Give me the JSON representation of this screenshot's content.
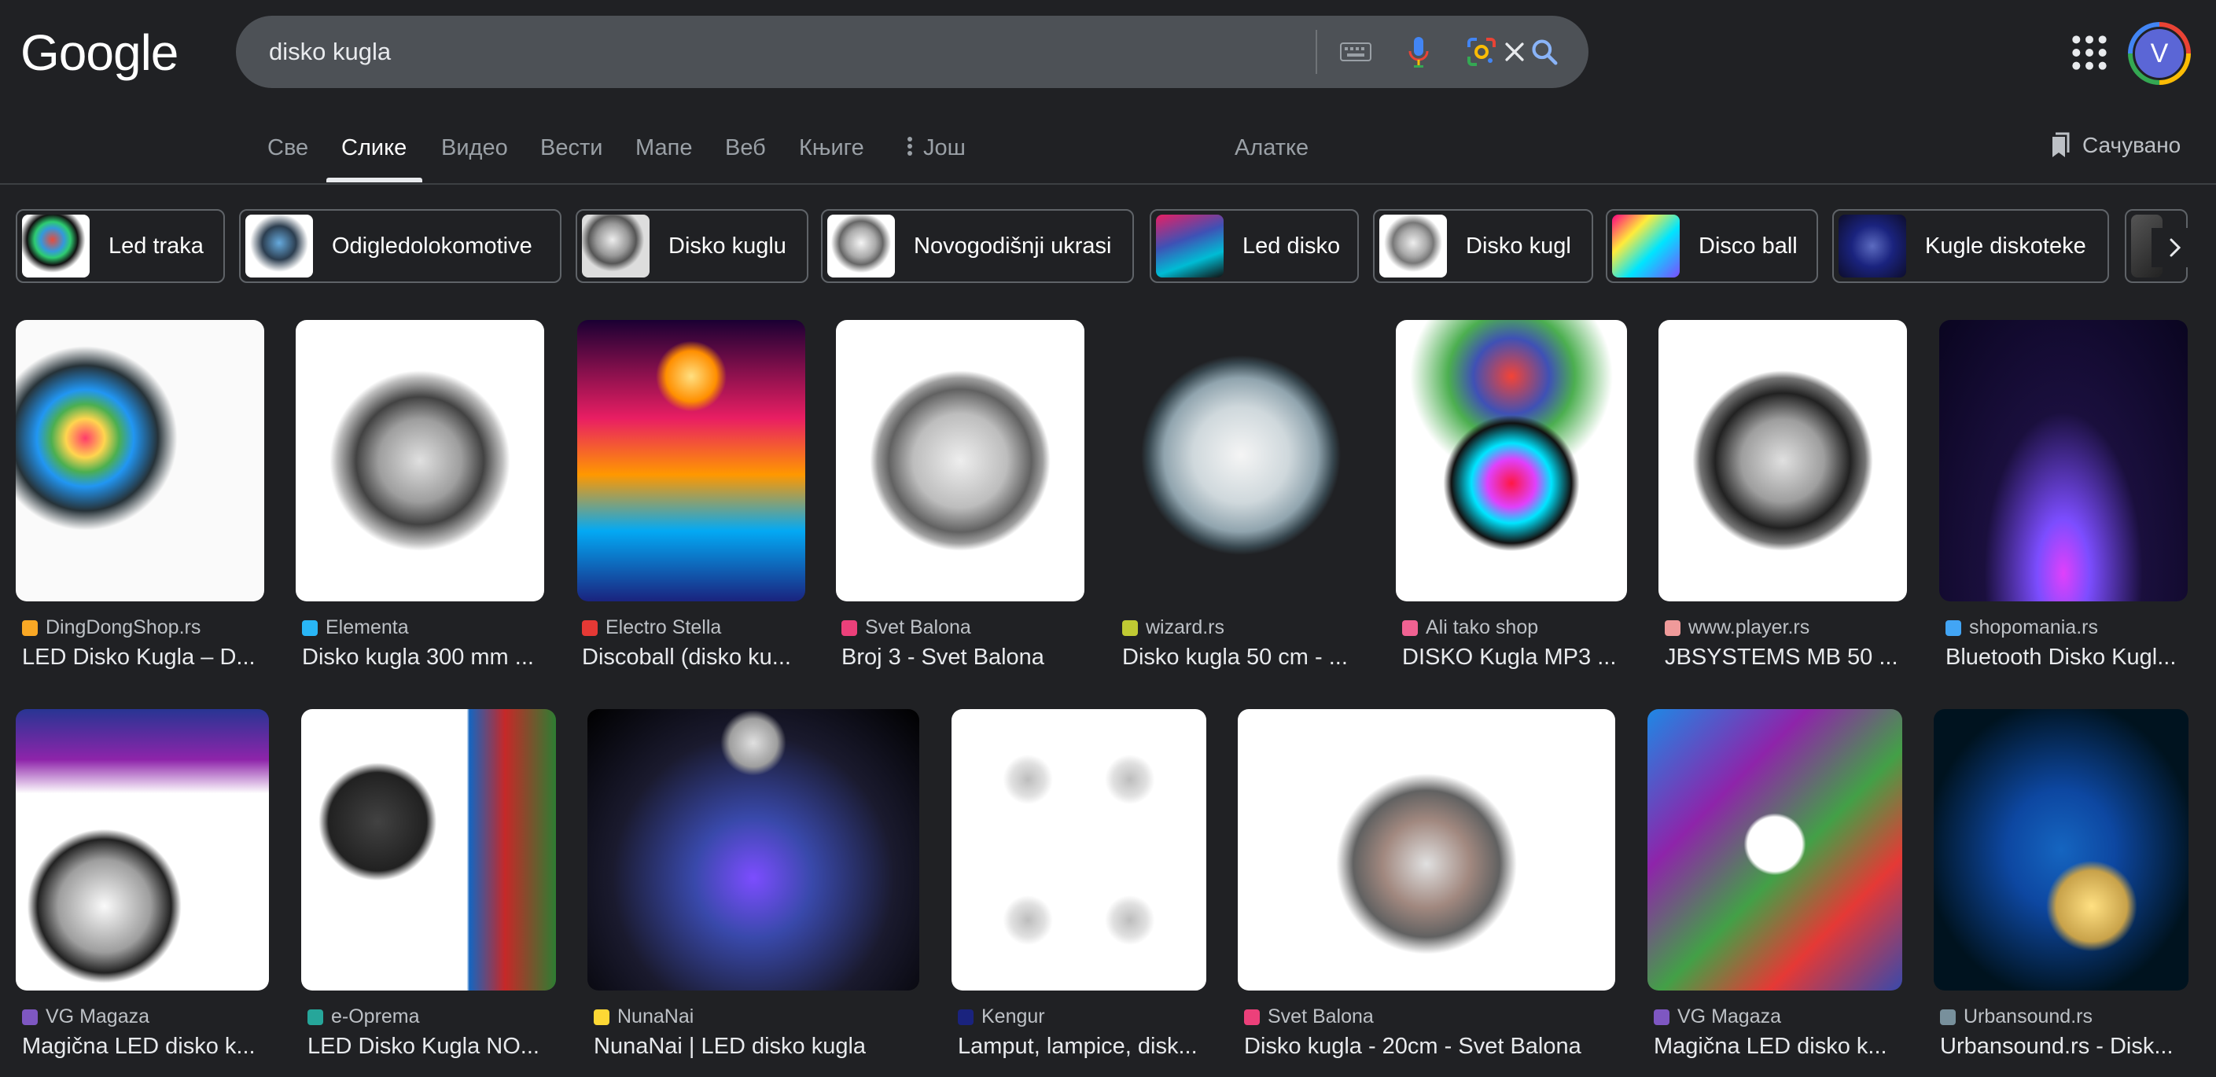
{
  "header": {
    "logo": "Google",
    "search_value": "disko kugla",
    "avatar_letter": "V"
  },
  "tabs": [
    {
      "label": "Све",
      "active": false
    },
    {
      "label": "Слике",
      "active": true
    },
    {
      "label": "Видео",
      "active": false
    },
    {
      "label": "Вести",
      "active": false
    },
    {
      "label": "Мапе",
      "active": false
    },
    {
      "label": "Веб",
      "active": false
    },
    {
      "label": "Књиге",
      "active": false
    },
    {
      "label": "Још",
      "active": false
    }
  ],
  "tools_label": "Алатке",
  "saved_label": "Сачувано",
  "chips": [
    {
      "label": "Led traka"
    },
    {
      "label": "Odigledolokomotive"
    },
    {
      "label": "Disko kuglu"
    },
    {
      "label": "Novogodišnji ukrasi"
    },
    {
      "label": "Led disko"
    },
    {
      "label": "Disko kugl"
    },
    {
      "label": "Disco ball"
    },
    {
      "label": "Kugle diskoteke"
    }
  ],
  "results": [
    {
      "source": "DingDongShop.rs",
      "title": "LED Disko Kugla – D..."
    },
    {
      "source": "Elementa",
      "title": "Disko kugla 300 mm ..."
    },
    {
      "source": "Electro Stella",
      "title": "Discoball (disko ku..."
    },
    {
      "source": "Svet Balona",
      "title": "Broj 3 - Svet Balona"
    },
    {
      "source": "wizard.rs",
      "title": "Disko kugla 50 cm - ..."
    },
    {
      "source": "Ali tako shop",
      "title": "DISKO Kugla MP3 ..."
    },
    {
      "source": "www.player.rs",
      "title": "JBSYSTEMS MB 50 ..."
    },
    {
      "source": "shopomania.rs",
      "title": "Bluetooth Disko Kugl..."
    },
    {
      "source": "VG Magaza",
      "title": "Magična LED disko k..."
    },
    {
      "source": "e-Oprema",
      "title": "LED Disko Kugla NO..."
    },
    {
      "source": "NunaNai",
      "title": "NunaNai | LED disko kugla"
    },
    {
      "source": "Kengur",
      "title": "Lamput, lampice, disk..."
    },
    {
      "source": "Svet Balona",
      "title": "Disko kugla - 20cm - Svet Balona"
    },
    {
      "source": "VG Magaza",
      "title": "Magična LED disko k..."
    },
    {
      "source": "Urbansound.rs",
      "title": "Urbansound.rs - Disk..."
    }
  ],
  "icons": {
    "clear": "close-icon",
    "keyboard": "keyboard-icon",
    "voice": "microphone-icon",
    "lens": "google-lens-icon",
    "search": "search-icon",
    "apps": "apps-grid-icon",
    "more": "more-vert-icon",
    "saved": "bookmark-icon",
    "chip_next": "chevron-right-icon"
  },
  "colors": {
    "background": "#202124",
    "search_bg": "#4d5156",
    "text": "#e8eaed",
    "muted": "#9aa0a6",
    "accent_blue": "#8ab4f8"
  }
}
